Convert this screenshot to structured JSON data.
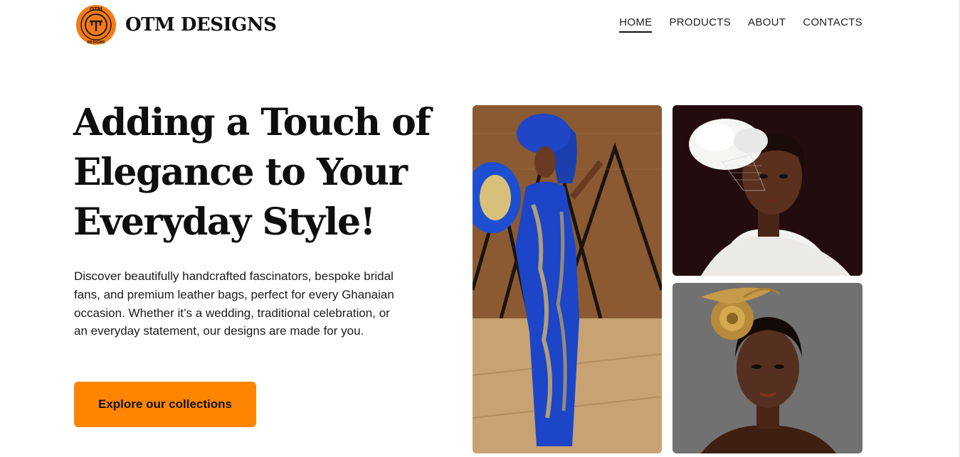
{
  "header": {
    "brand": "OTM DESIGNS",
    "logo_badge_text_top": "OTM",
    "logo_badge_text_bottom": "DESIGNS",
    "nav": [
      {
        "label": "HOME",
        "active": true
      },
      {
        "label": "PRODUCTS",
        "active": false
      },
      {
        "label": "ABOUT",
        "active": false
      },
      {
        "label": "CONTACTS",
        "active": false
      }
    ]
  },
  "hero": {
    "title_lines": [
      "Adding a Touch of",
      "Elegance to Your",
      "Everyday Style!"
    ],
    "description": "Discover beautifully handcrafted fascinators, bespoke bridal fans, and premium leather bags, perfect for every Ghanaian occasion. Whether it’s a wedding, traditional celebration, or an everyday statement, our designs are made for you.",
    "cta_label": "Explore our collections"
  },
  "gallery": [
    {
      "subject": "woman-in-blue-gele-with-feather-fan"
    },
    {
      "subject": "woman-with-white-feather-fascinator-veil"
    },
    {
      "subject": "woman-with-gold-floral-fascinator"
    }
  ],
  "colors": {
    "accent": "#ff8500",
    "text": "#111111",
    "background": "#ffffff"
  }
}
